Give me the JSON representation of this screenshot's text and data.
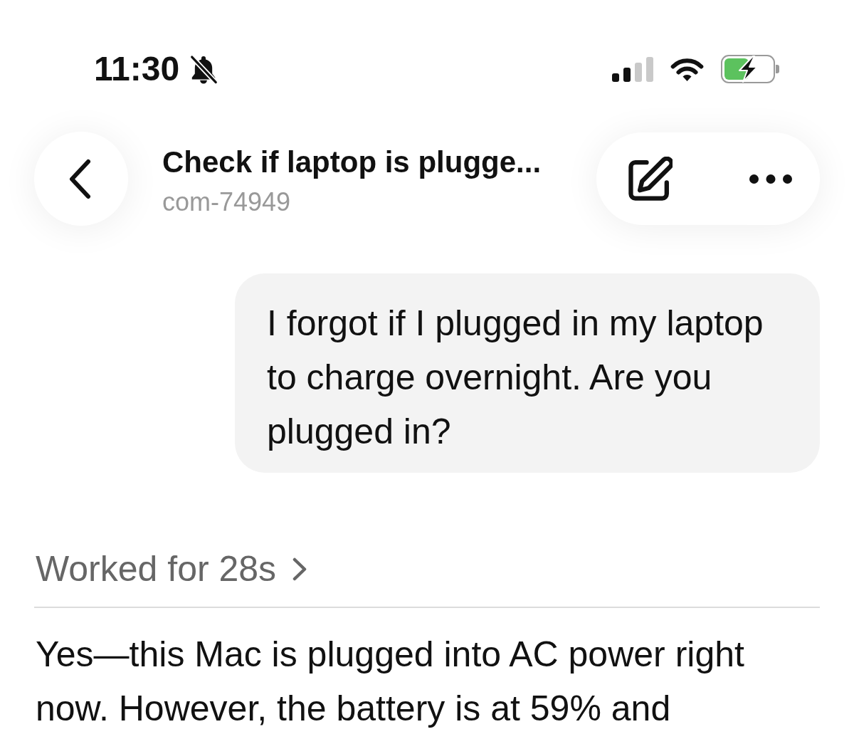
{
  "status_bar": {
    "time": "11:30",
    "silent": true
  },
  "header": {
    "title": "Check if laptop is plugge...",
    "subtitle": "com-74949"
  },
  "messages": [
    {
      "kind": "user",
      "text": "I forgot if I plugged in my laptop to charge overnight. Are you plugged in?"
    },
    {
      "kind": "work_summary",
      "text": "Worked for 28s"
    },
    {
      "kind": "assistant",
      "text": "Yes—this Mac is plugged into AC power right now. However, the battery is at 59% and"
    }
  ]
}
